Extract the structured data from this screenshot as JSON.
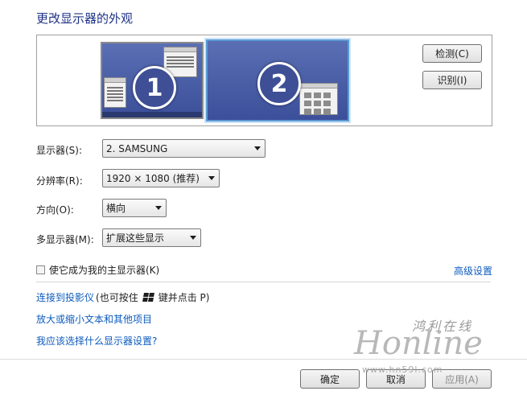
{
  "page": {
    "title": "更改显示器的外观"
  },
  "monitors": {
    "items": [
      {
        "number": "1"
      },
      {
        "number": "2"
      }
    ],
    "detect_label": "检测(C)",
    "identify_label": "识别(I)"
  },
  "settings": {
    "display": {
      "label": "显示器(S):",
      "value": "2. SAMSUNG"
    },
    "resolution": {
      "label": "分辨率(R):",
      "value": "1920 × 1080 (推荐)"
    },
    "orientation": {
      "label": "方向(O):",
      "value": "横向"
    },
    "multiple": {
      "label": "多显示器(M):",
      "value": "扩展这些显示"
    }
  },
  "main_display_checkbox": {
    "label": "使它成为我的主显示器(K)",
    "checked": false
  },
  "advanced_link": "高级设置",
  "links": {
    "projector": "连接到投影仪",
    "projector_hint_before": "(也可按住",
    "projector_hint_after": "键并点击 P)",
    "text_size": "放大或缩小文本和其他项目",
    "which_settings": "我应该选择什么显示器设置?"
  },
  "footer": {
    "ok": "确定",
    "cancel": "取消",
    "apply": "应用(A)"
  },
  "watermark": {
    "small": "鸿利在线",
    "big": "Honline",
    "url": "www.hn59l.com"
  }
}
